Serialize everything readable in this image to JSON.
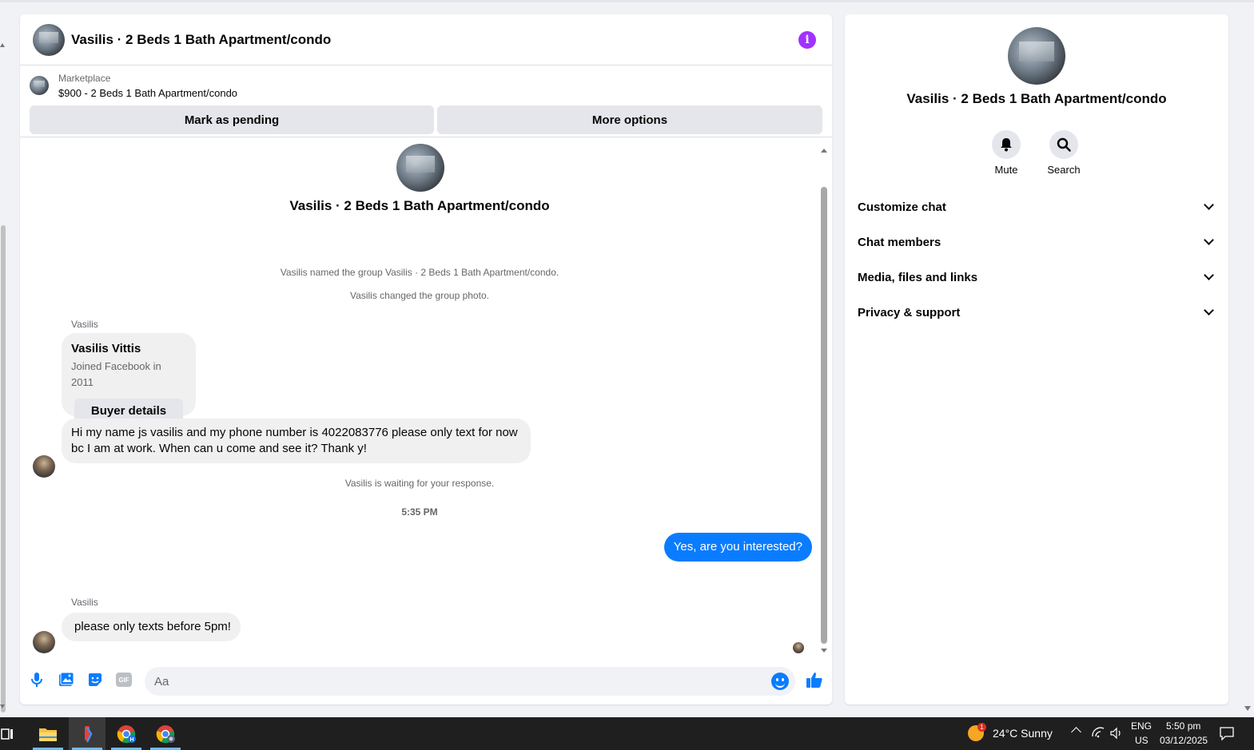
{
  "chat": {
    "title": "Vasilis · 2 Beds 1 Bath Apartment/condo",
    "info_icon": "i",
    "marketplace_label": "Marketplace",
    "listing": "$900 - 2 Beds 1 Bath Apartment/condo",
    "mark_pending": "Mark as pending",
    "more_options": "More options"
  },
  "messages": {
    "intro_name": "Vasilis · 2 Beds 1 Bath Apartment/condo",
    "sys_named": "Vasilis named the group Vasilis · 2 Beds 1 Bath Apartment/condo.",
    "sys_photo": "Vasilis changed the group photo.",
    "sender_1": "Vasilis",
    "card_name": "Vasilis Vittis",
    "card_sub": "Joined Facebook in 2011",
    "card_button": "Buyer details",
    "msg_1": "Hi my name js vasilis and my phone number is 4022083776 please only text for now bc I am at work. When can u come and see it? Thank y!",
    "sys_waiting": "Vasilis is waiting for your response.",
    "time": "5:35 PM",
    "out_1": "Yes, are you interested?",
    "sender_2": "Vasilis",
    "msg_2": "please only texts before 5pm!"
  },
  "composer": {
    "placeholder": "Aa",
    "gif_label": "GIF"
  },
  "info": {
    "name": "Vasilis · 2 Beds 1 Bath Apartment/condo",
    "mute": "Mute",
    "search": "Search",
    "sections": [
      "Customize chat",
      "Chat members",
      "Media, files and links",
      "Privacy & support"
    ]
  },
  "taskbar": {
    "weather_badge": "1",
    "weather": "24°C  Sunny",
    "lang_1": "ENG",
    "lang_2": "US",
    "clock_time": "5:50 pm",
    "clock_date": "03/12/2025"
  },
  "colors": {
    "accent": "#0a7cff",
    "info": "#a033ff",
    "bubble": "#f0f0f0",
    "taskbar": "#1f1f1f"
  }
}
